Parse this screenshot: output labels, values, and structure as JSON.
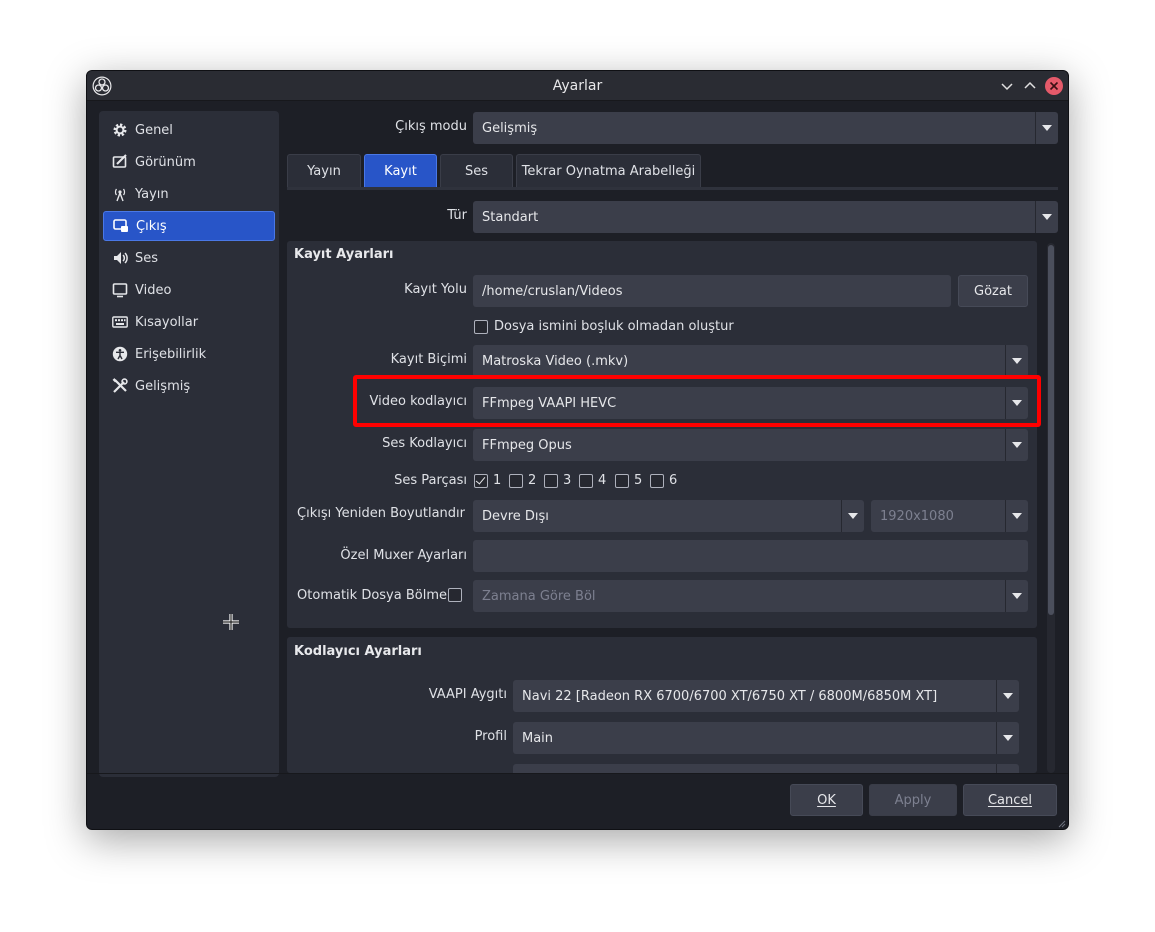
{
  "window": {
    "title": "Ayarlar"
  },
  "sidebar": {
    "items": [
      {
        "label": "Genel",
        "icon": "gear-icon"
      },
      {
        "label": "Görünüm",
        "icon": "appearance-icon"
      },
      {
        "label": "Yayın",
        "icon": "broadcast-icon"
      },
      {
        "label": "Çıkış",
        "icon": "output-icon",
        "active": true
      },
      {
        "label": "Ses",
        "icon": "speaker-icon"
      },
      {
        "label": "Video",
        "icon": "monitor-icon"
      },
      {
        "label": "Kısayollar",
        "icon": "keyboard-icon"
      },
      {
        "label": "Erişebilirlik",
        "icon": "accessibility-icon"
      },
      {
        "label": "Gelişmiş",
        "icon": "tools-icon"
      }
    ]
  },
  "output_mode": {
    "label": "Çıkış modu",
    "value": "Gelişmiş"
  },
  "tabs": [
    {
      "label": "Yayın"
    },
    {
      "label": "Kayıt",
      "active": true
    },
    {
      "label": "Ses"
    },
    {
      "label": "Tekrar Oynatma Arabelleği"
    }
  ],
  "type": {
    "label": "Tür",
    "value": "Standart"
  },
  "recording": {
    "title": "Kayıt Ayarları",
    "path_label": "Kayıt Yolu",
    "path_value": "/home/cruslan/Videos",
    "browse_label": "Gözat",
    "no_space_label": "Dosya ismini boşluk olmadan oluştur",
    "format_label": "Kayıt Biçimi",
    "format_value": "Matroska Video (.mkv)",
    "video_encoder_label": "Video kodlayıcı",
    "video_encoder_value": "FFmpeg VAAPI HEVC",
    "audio_encoder_label": "Ses Kodlayıcı",
    "audio_encoder_value": "FFmpeg Opus",
    "audio_track_label": "Ses Parçası",
    "tracks": [
      "1",
      "2",
      "3",
      "4",
      "5",
      "6"
    ],
    "rescale_label": "Çıkışı Yeniden Boyutlandır",
    "rescale_value": "Devre Dışı",
    "rescale_resolution": "1920x1080",
    "muxer_label": "Özel Muxer Ayarları",
    "muxer_value": "",
    "autosplit_label": "Otomatik Dosya Bölme",
    "autosplit_value": "Zamana Göre Böl"
  },
  "encoder": {
    "title": "Kodlayıcı Ayarları",
    "vaapi_label": "VAAPI Aygıtı",
    "vaapi_value": "Navi 22 [Radeon RX 6700/6700 XT/6750 XT / 6800M/6850M XT]",
    "profile_label": "Profil",
    "profile_value": "Main"
  },
  "footer": {
    "ok": "OK",
    "apply": "Apply",
    "cancel": "Cancel"
  },
  "colors": {
    "accent": "#2855c8",
    "highlight": "#ff0000",
    "background": "#1d1f26"
  }
}
